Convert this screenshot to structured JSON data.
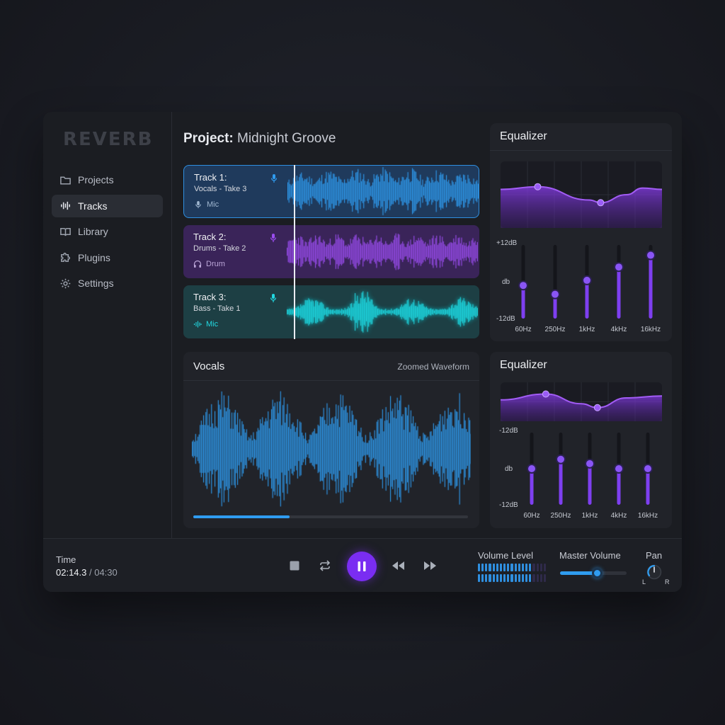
{
  "brand": "REVERB",
  "sidebar": {
    "items": [
      {
        "label": "Projects",
        "icon": "folder-icon",
        "active": false
      },
      {
        "label": "Tracks",
        "icon": "waveform-icon",
        "active": true
      },
      {
        "label": "Library",
        "icon": "book-icon",
        "active": false
      },
      {
        "label": "Plugins",
        "icon": "puzzle-icon",
        "active": false
      },
      {
        "label": "Settings",
        "icon": "gear-icon",
        "active": false
      }
    ]
  },
  "project": {
    "prefix": "Project:",
    "name": "Midnight Groove"
  },
  "tracks": [
    {
      "name": "Track 1:",
      "sub": "Vocals - Take 3",
      "instrument": "Mic",
      "instrument_icon": "mic-icon",
      "color": "#2f9cf0"
    },
    {
      "name": "Track 2:",
      "sub": "Drums - Take 2",
      "instrument": "Drum",
      "instrument_icon": "headphones-icon",
      "color": "#9b4df0"
    },
    {
      "name": "Track 3:",
      "sub": "Bass - Take 1",
      "instrument": "Mic",
      "instrument_icon": "waveform-icon",
      "color": "#22d8e0"
    }
  ],
  "vocals_panel": {
    "title": "Vocals",
    "subtitle": "Zoomed Waveform",
    "progress": 0.35
  },
  "equalizers": [
    {
      "title": "Equalizer",
      "top_label": "+12dB",
      "mid_label": "db",
      "bottom_label": "-12dB",
      "bands": [
        "60Hz",
        "250Hz",
        "1kHz",
        "4kHz",
        "16kHz"
      ],
      "levels": [
        0.45,
        0.33,
        0.52,
        0.7,
        0.86
      ]
    },
    {
      "title": "Equalizer",
      "top_label": "-12dB",
      "mid_label": "db",
      "bottom_label": "-12dB",
      "bands": [
        "60Hz",
        "250Hz",
        "1kHz",
        "4kHz",
        "16kHz"
      ],
      "levels": [
        0.5,
        0.63,
        0.57,
        0.5,
        0.5
      ]
    }
  ],
  "transport": {
    "time_label": "Time",
    "current": "02:14.3",
    "separator": " / ",
    "total": "04:30",
    "volume_label": "Volume Level",
    "master_label": "Master Volume",
    "master_value": 0.55,
    "pan_label": "Pan",
    "pan_left": "L",
    "pan_right": "R",
    "meter_lit": [
      15,
      15
    ],
    "meter_total": 19
  },
  "colors": {
    "accent": "#7a2df2",
    "blue": "#2f9cf0",
    "purple": "#9b4df0",
    "cyan": "#22d8e0"
  }
}
